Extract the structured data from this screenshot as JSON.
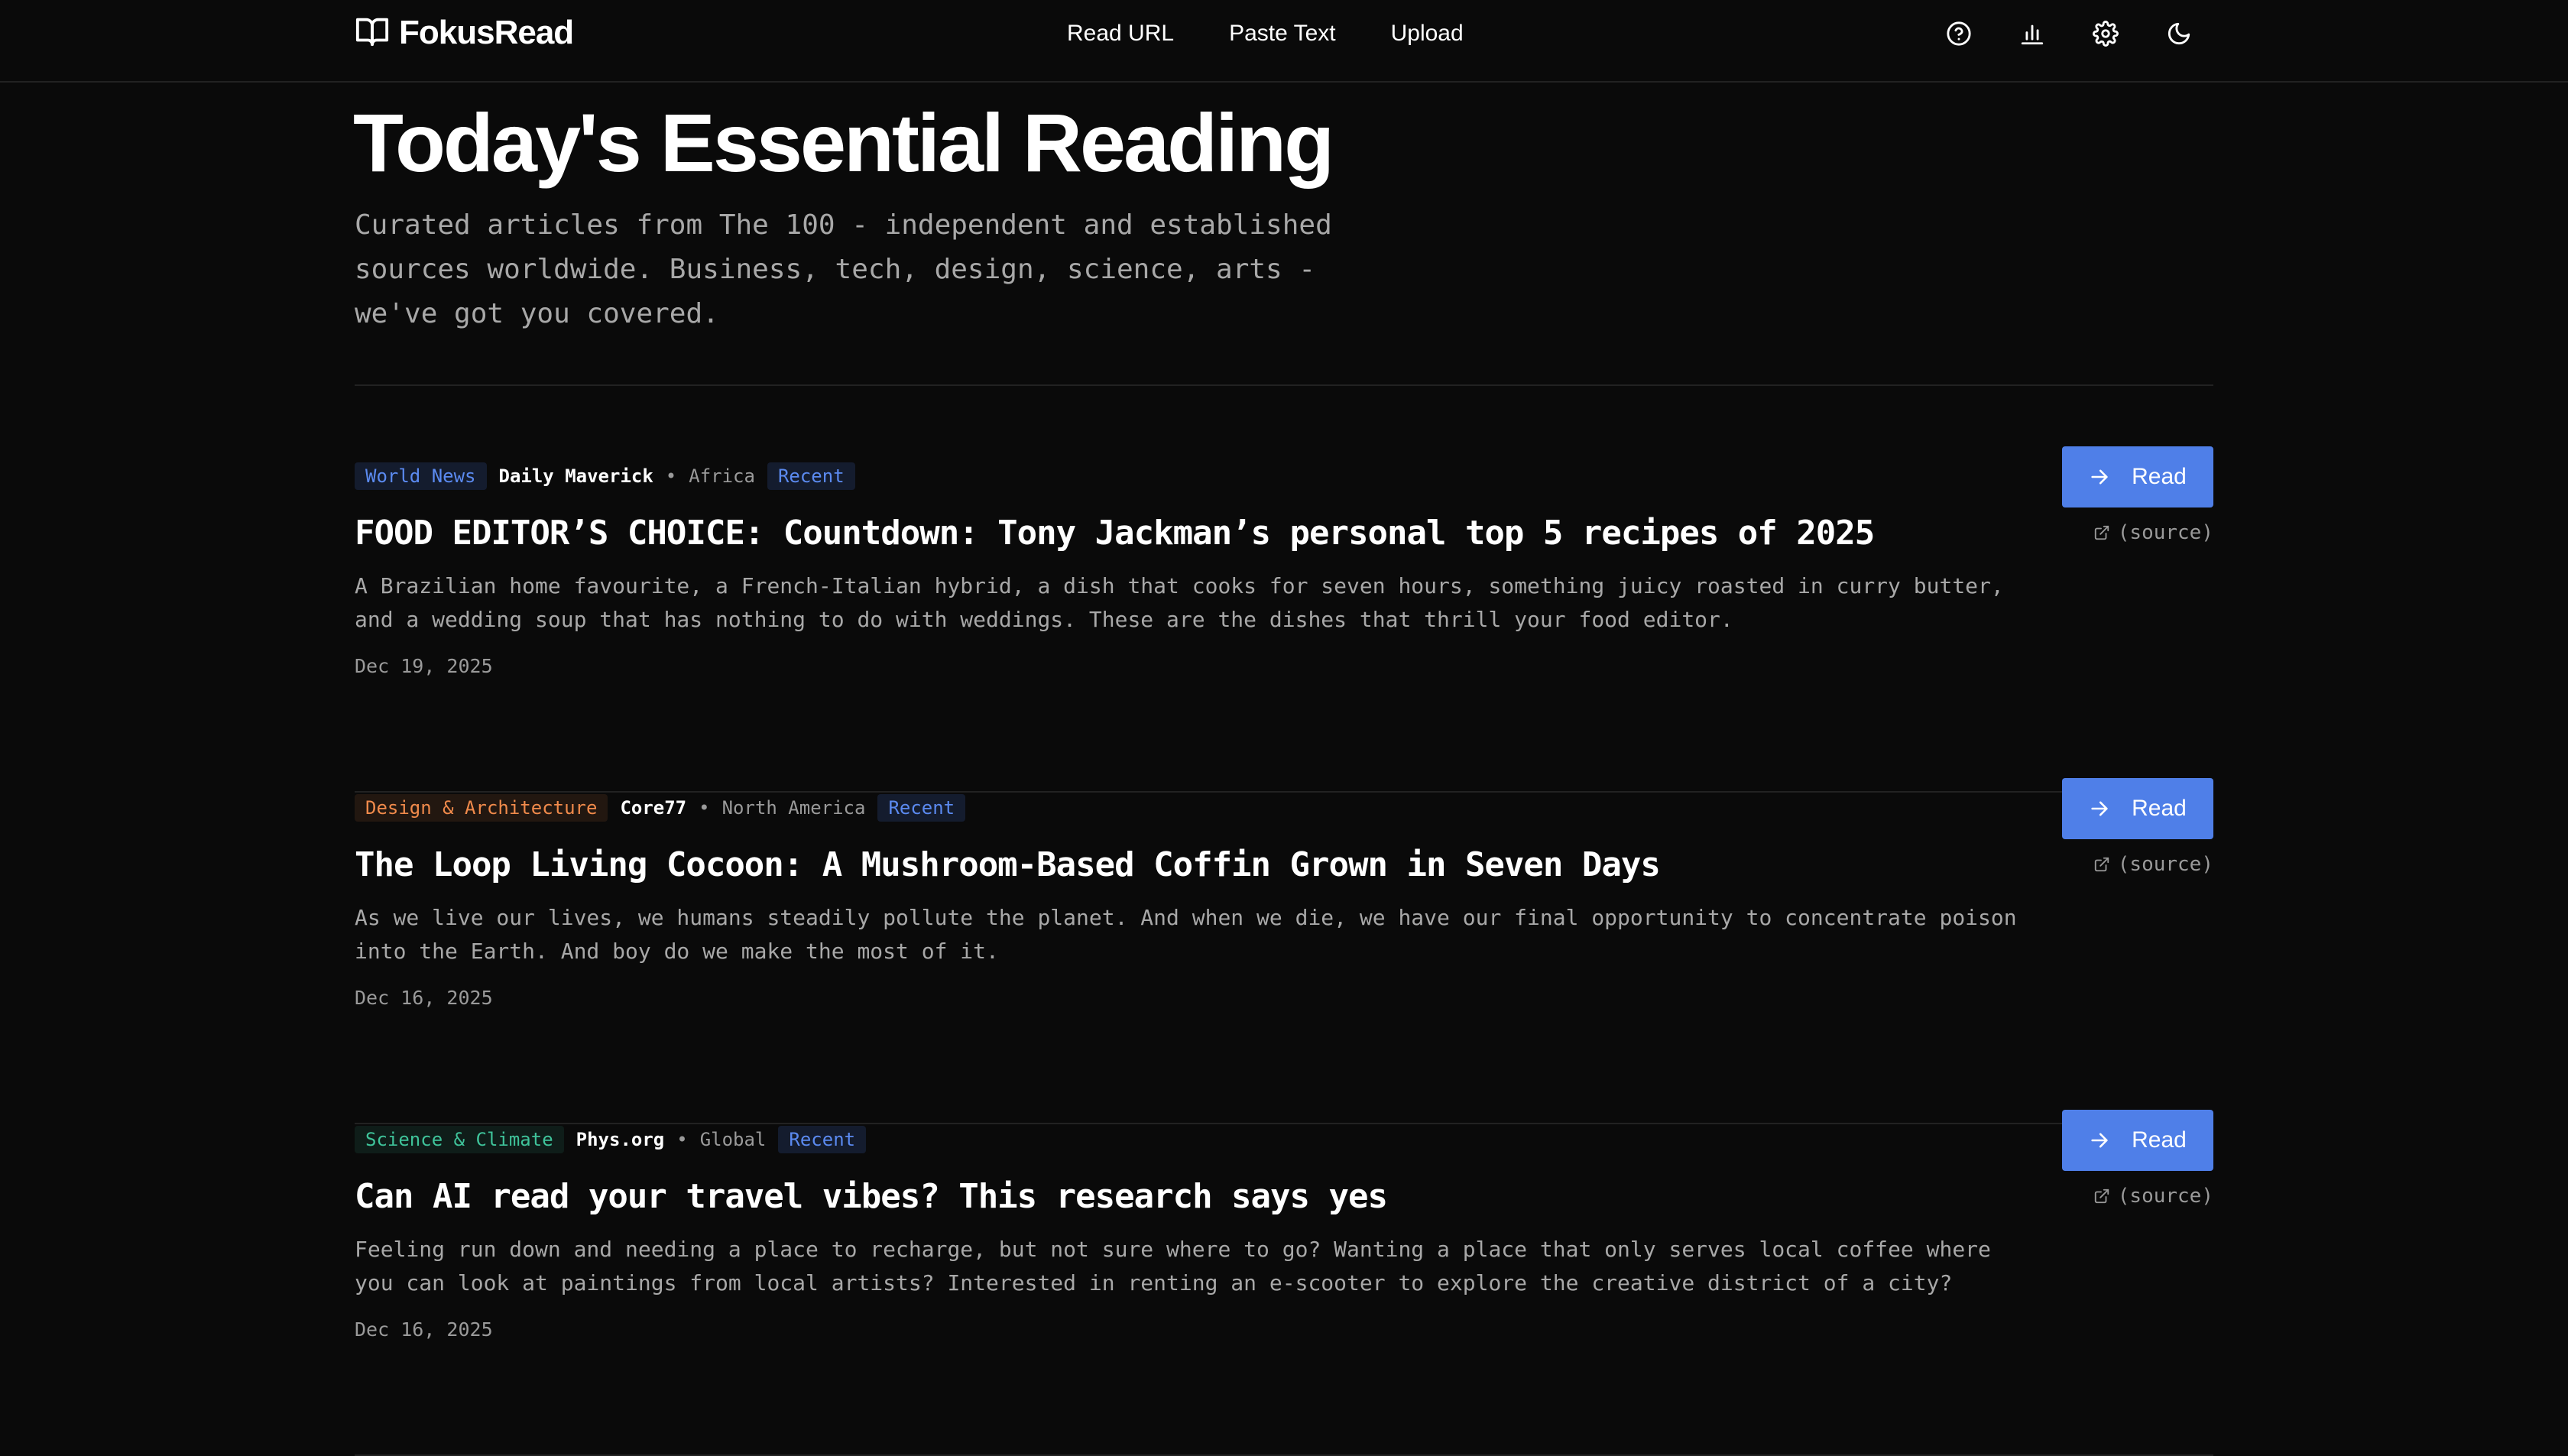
{
  "app": {
    "name": "FokusRead"
  },
  "nav": [
    {
      "label": "Read URL"
    },
    {
      "label": "Paste Text"
    },
    {
      "label": "Upload"
    }
  ],
  "header_icons": [
    "help-icon",
    "stats-icon",
    "settings-icon",
    "theme-moon-icon"
  ],
  "hero": {
    "title": "Today's Essential Reading",
    "subtitle": "Curated articles from The 100 - independent and established sources worldwide. Business, tech, design, science, arts - we've got you covered."
  },
  "articles": [
    {
      "category": "World News",
      "category_color": "#5b8af0",
      "category_bg": "#141c2e",
      "source": "Daily Maverick",
      "region": "Africa",
      "badge": "Recent",
      "title": "FOOD EDITOR’S CHOICE: Countdown: Tony Jackman’s personal top 5 recipes of 2025",
      "description": "A Brazilian home favourite, a French-Italian hybrid, a dish that cooks for seven hours, something juicy roasted in curry butter, and a wedding soup that has nothing to do with weddings. These are the dishes that thrill your food editor.",
      "date": "Dec 19, 2025",
      "read_label": "Read",
      "source_link_label": "(source)"
    },
    {
      "category": "Design & Architecture",
      "category_color": "#f08a4b",
      "category_bg": "#221710",
      "source": "Core77",
      "region": "North America",
      "badge": "Recent",
      "title": "The Loop Living Cocoon: A Mushroom-Based Coffin Grown in Seven Days",
      "description": "As we live our lives, we humans steadily pollute the planet. And when we die, we have our final opportunity to concentrate poison into the Earth. And boy do we make the most of it.",
      "date": "Dec 16, 2025",
      "read_label": "Read",
      "source_link_label": "(source)"
    },
    {
      "category": "Science & Climate",
      "category_color": "#3fc39a",
      "category_bg": "#0f1d19",
      "source": "Phys.org",
      "region": "Global",
      "badge": "Recent",
      "title": "Can AI read your travel vibes? This research says yes",
      "description": "Feeling run down and needing a place to recharge, but not sure where to go? Wanting a place that only serves local coffee where you can look at paintings from local artists? Interested in renting an e-scooter to explore the creative district of a city?",
      "date": "Dec 16, 2025",
      "read_label": "Read",
      "source_link_label": "(source)"
    }
  ],
  "meta_separator": "•",
  "colors": {
    "background": "#0a0a0a",
    "accent": "#4f7fe8",
    "muted_text": "#a8a8a8",
    "divider": "#222222"
  }
}
